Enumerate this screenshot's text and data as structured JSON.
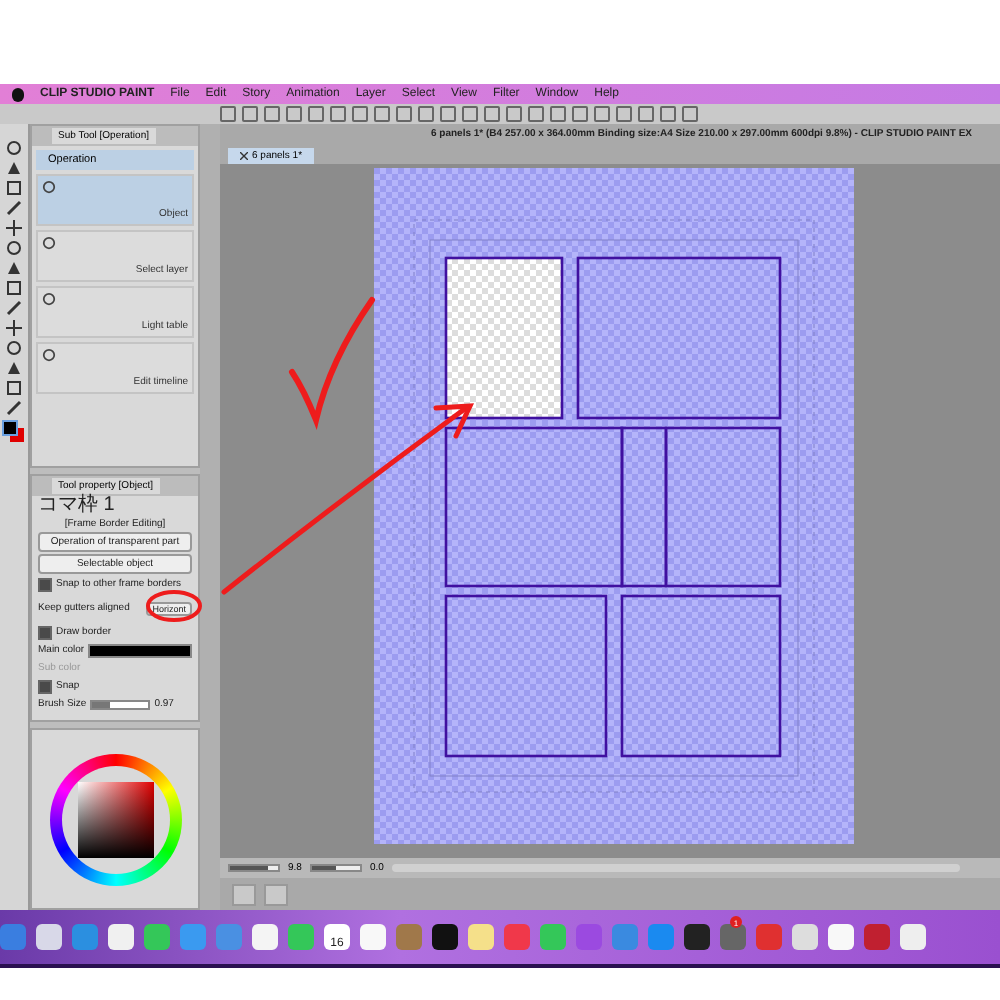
{
  "menu_bar": {
    "app_name": "CLIP STUDIO PAINT",
    "items": [
      "File",
      "Edit",
      "Story",
      "Animation",
      "Layer",
      "Select",
      "View",
      "Filter",
      "Window",
      "Help"
    ]
  },
  "sub_tool": {
    "title": "Sub Tool [Operation]",
    "group": "Operation",
    "items": [
      {
        "label": "Object",
        "selected": true
      },
      {
        "label": "Select layer",
        "selected": false
      },
      {
        "label": "Light table",
        "selected": false
      },
      {
        "label": "Edit timeline",
        "selected": false
      }
    ]
  },
  "tool_property": {
    "title": "Tool property [Object]",
    "frame_name": "コマ枠 1",
    "mode": "[Frame Border Editing]",
    "dropdowns": [
      "Operation of transparent part",
      "Selectable object"
    ],
    "rows": [
      {
        "kind": "checkbox",
        "label": "Snap to other frame borders",
        "checked": true
      },
      {
        "kind": "select",
        "label": "Keep gutters aligned",
        "value": "Horizont"
      },
      {
        "kind": "checkbox",
        "label": "Draw border",
        "checked": true
      },
      {
        "kind": "color",
        "label": "Main color",
        "disabled": false
      },
      {
        "kind": "color",
        "label": "Sub color",
        "disabled": true
      },
      {
        "kind": "checkbox",
        "label": "Snap",
        "checked": true
      },
      {
        "kind": "slider",
        "label": "Brush Size",
        "value": "0.97",
        "level": 0.3
      }
    ]
  },
  "document": {
    "title": "6 panels 1* (B4 257.00 x 364.00mm Binding size:A4 Size 210.00 x 297.00mm 600dpi 9.8%)  - CLIP STUDIO PAINT EX",
    "tab": "6 panels 1*",
    "panels": [
      {
        "selected": true
      },
      {
        "selected": false
      },
      {
        "selected": false
      },
      {
        "selected": false
      },
      {
        "selected": false
      },
      {
        "selected": false
      },
      {
        "selected": false
      }
    ]
  },
  "status_bar": {
    "zoom": {
      "value": "9.8",
      "level": 0.8
    },
    "angle": {
      "value": "0.0",
      "level": 0.5
    }
  },
  "dock": {
    "calendar_day": "16",
    "badge": "1"
  }
}
